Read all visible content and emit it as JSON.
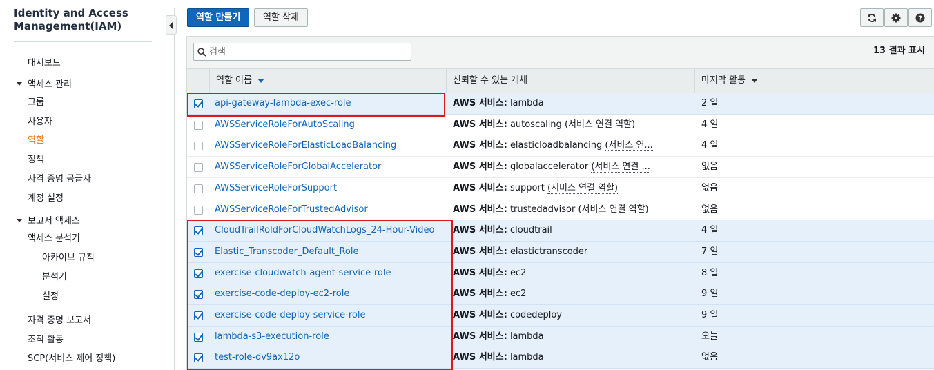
{
  "sidebar": {
    "title": "Identity and Access Management(IAM)",
    "dashboard": "대시보드",
    "access_mgmt": "액세스 관리",
    "groups": "그룹",
    "users": "사용자",
    "roles": "역할",
    "policies": "정책",
    "identity_providers": "자격 증명 공급자",
    "account_settings": "계정 설정",
    "reports_access": "보고서 액세스",
    "access_analyzer": "액세스 분석기",
    "archive_rules": "아카이브 규칙",
    "analyzers": "분석기",
    "settings": "설정",
    "credential_report": "자격 증명 보고서",
    "org_activity": "조직 활동",
    "scp": "SCP(서비스 제어 정책)"
  },
  "toolbar": {
    "create_role": "역할 만들기",
    "delete_role": "역할 삭제"
  },
  "search": {
    "placeholder": "검색"
  },
  "result_count": "13 결과 표시",
  "columns": {
    "role_name": "역할 이름",
    "trusted_entity": "신뢰할 수 있는 개체",
    "last_activity": "마지막 활동"
  },
  "rows": [
    {
      "name": "api-gateway-lambda-exec-role",
      "entity_prefix": "AWS 서비스:",
      "entity": "lambda",
      "entity_note": "",
      "activity": "2 일",
      "checked": true
    },
    {
      "name": "AWSServiceRoleForAutoScaling",
      "entity_prefix": "AWS 서비스:",
      "entity": "autoscaling",
      "entity_note": "(서비스 연결 역할)",
      "activity": "4 일",
      "checked": false
    },
    {
      "name": "AWSServiceRoleForElasticLoadBalancing",
      "entity_prefix": "AWS 서비스:",
      "entity": "elasticloadbalancing",
      "entity_note": "(서비스 연...",
      "activity": "4 일",
      "checked": false
    },
    {
      "name": "AWSServiceRoleForGlobalAccelerator",
      "entity_prefix": "AWS 서비스:",
      "entity": "globalaccelerator",
      "entity_note": "(서비스 연결 ...",
      "activity": "없음",
      "checked": false
    },
    {
      "name": "AWSServiceRoleForSupport",
      "entity_prefix": "AWS 서비스:",
      "entity": "support",
      "entity_note": "(서비스 연결 역할)",
      "activity": "없음",
      "checked": false
    },
    {
      "name": "AWSServiceRoleForTrustedAdvisor",
      "entity_prefix": "AWS 서비스:",
      "entity": "trustedadvisor",
      "entity_note": "(서비스 연결 역할)",
      "activity": "없음",
      "checked": false
    },
    {
      "name": "CloudTrailRoldForCloudWatchLogs_24-Hour-Video",
      "entity_prefix": "AWS 서비스:",
      "entity": "cloudtrail",
      "entity_note": "",
      "activity": "4 일",
      "checked": true
    },
    {
      "name": "Elastic_Transcoder_Default_Role",
      "entity_prefix": "AWS 서비스:",
      "entity": "elastictranscoder",
      "entity_note": "",
      "activity": "7 일",
      "checked": true
    },
    {
      "name": "exercise-cloudwatch-agent-service-role",
      "entity_prefix": "AWS 서비스:",
      "entity": "ec2",
      "entity_note": "",
      "activity": "8 일",
      "checked": true
    },
    {
      "name": "exercise-code-deploy-ec2-role",
      "entity_prefix": "AWS 서비스:",
      "entity": "ec2",
      "entity_note": "",
      "activity": "9 일",
      "checked": true
    },
    {
      "name": "exercise-code-deploy-service-role",
      "entity_prefix": "AWS 서비스:",
      "entity": "codedeploy",
      "entity_note": "",
      "activity": "9 일",
      "checked": true
    },
    {
      "name": "lambda-s3-execution-role",
      "entity_prefix": "AWS 서비스:",
      "entity": "lambda",
      "entity_note": "",
      "activity": "오늘",
      "checked": true
    },
    {
      "name": "test-role-dv9ax12o",
      "entity_prefix": "AWS 서비스:",
      "entity": "lambda",
      "entity_note": "",
      "activity": "없음",
      "checked": true
    }
  ],
  "icons": {
    "refresh": "refresh-icon",
    "settings": "gear-icon",
    "help": "help-icon",
    "search": "search-icon",
    "collapse": "chevron-left-icon"
  },
  "colors": {
    "primary": "#1166bb",
    "active_nav": "#ec7211",
    "highlight_box": "#e0161c",
    "selected_row": "#e6f0fa"
  }
}
